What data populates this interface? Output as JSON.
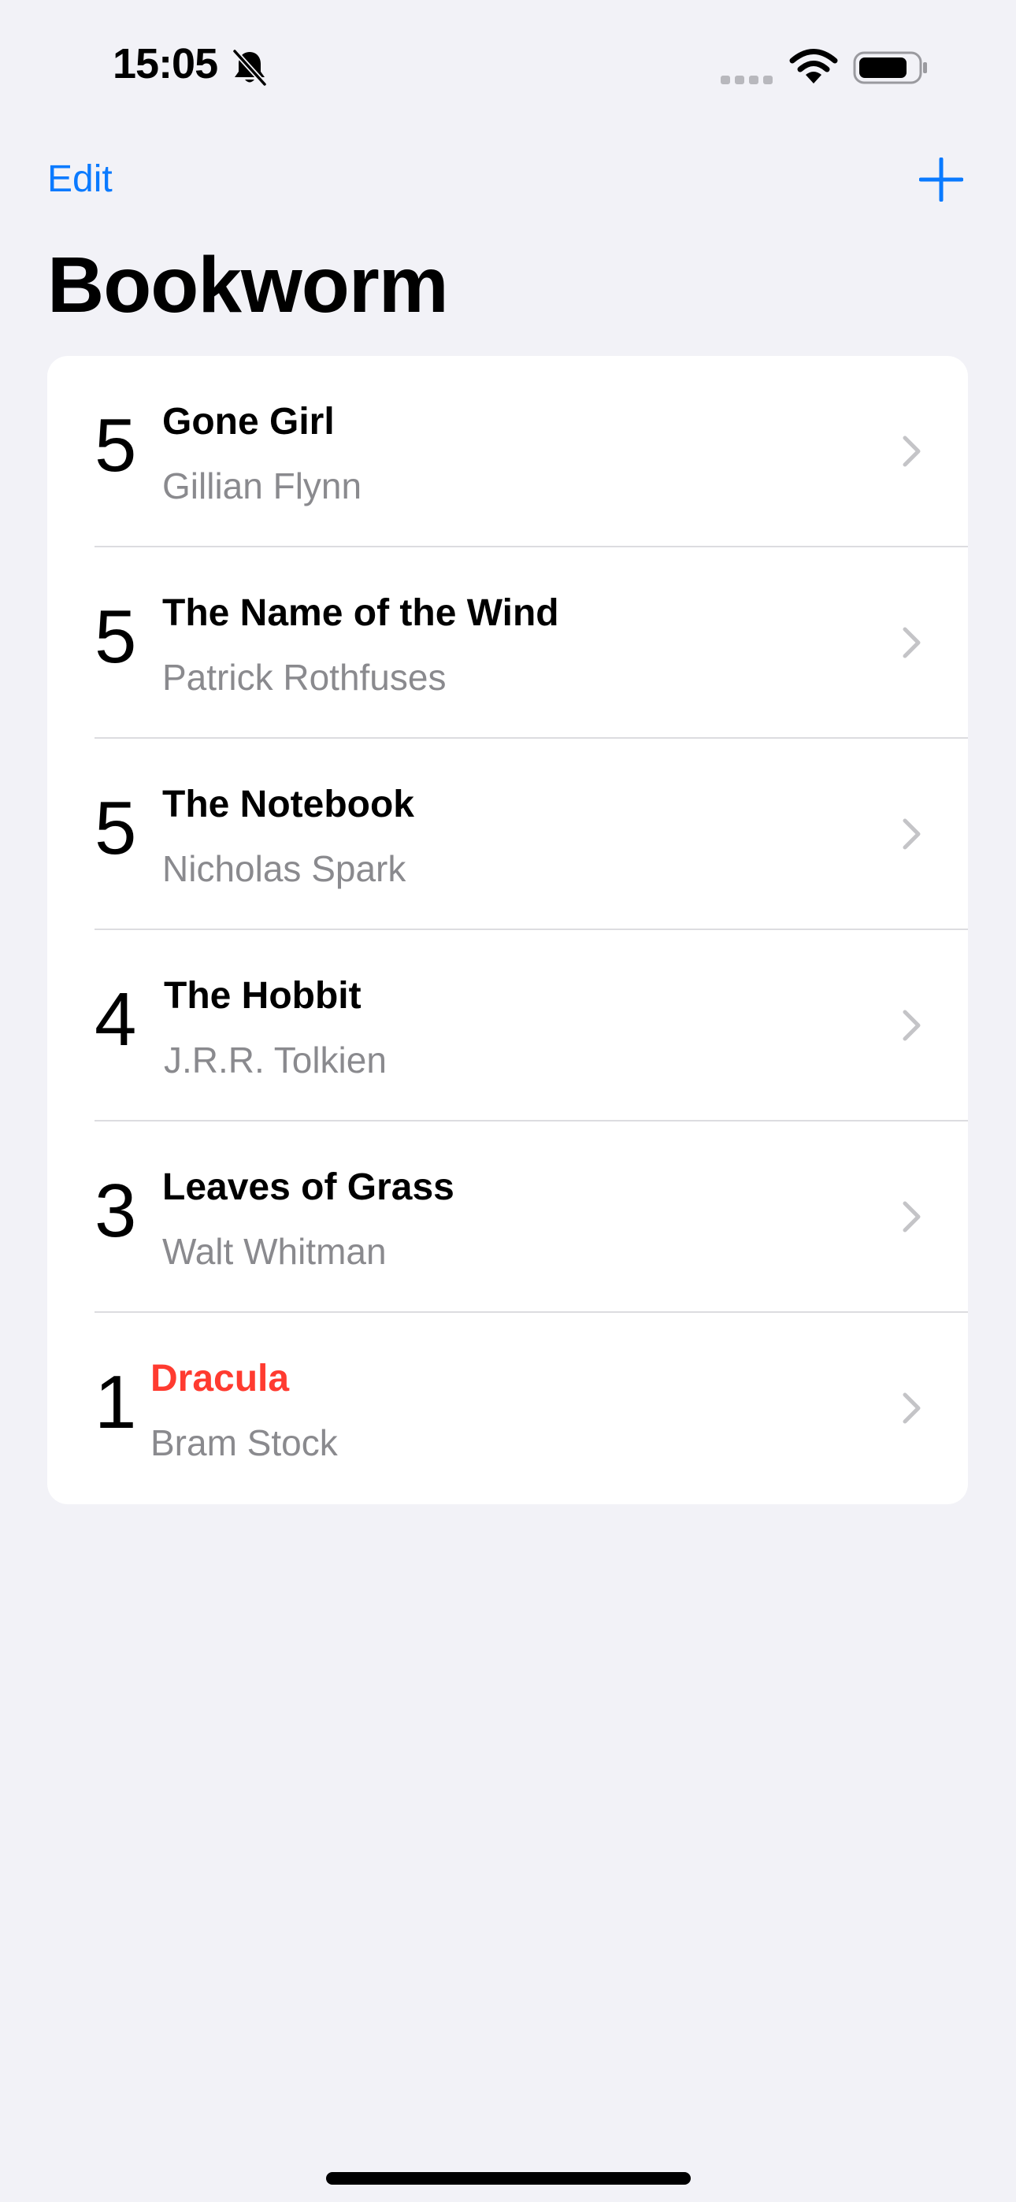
{
  "status_bar": {
    "time": "15:05",
    "icons": [
      "bell-slash-icon",
      "cellular-signal-icon",
      "wifi-icon",
      "battery-icon"
    ]
  },
  "nav": {
    "edit_label": "Edit",
    "add_icon": "plus-icon",
    "title": "Bookworm"
  },
  "colors": {
    "accent": "#0a7aff",
    "low_rating_title": "#ff3b30",
    "secondary_text": "#8a8a8e",
    "background": "#f2f2f7"
  },
  "books": [
    {
      "rating": "5",
      "title": "Gone Girl",
      "author": "Gillian Flynn"
    },
    {
      "rating": "5",
      "title": "The Name of the Wind",
      "author": "Patrick Rothfuses"
    },
    {
      "rating": "5",
      "title": "The Notebook",
      "author": "Nicholas Spark"
    },
    {
      "rating": "4",
      "title": "The Hobbit",
      "author": "J.R.R. Tolkien"
    },
    {
      "rating": "3",
      "title": "Leaves of Grass",
      "author": "Walt Whitman"
    },
    {
      "rating": "1",
      "title": "Dracula",
      "author": "Bram Stock",
      "highlight": true
    }
  ]
}
